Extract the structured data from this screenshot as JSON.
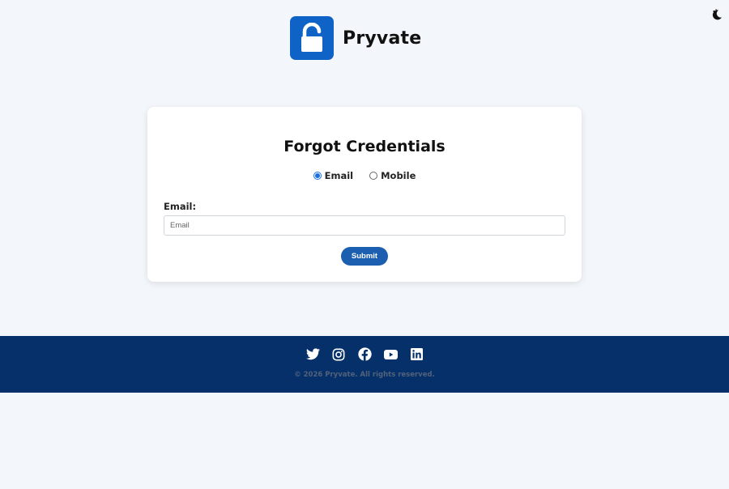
{
  "brand": {
    "name": "Pryvate",
    "accent": "#0f63c7"
  },
  "theme_toggle": {
    "icon": "moon-icon"
  },
  "form": {
    "title": "Forgot Credentials",
    "methods": [
      {
        "label": "Email",
        "checked": true
      },
      {
        "label": "Mobile",
        "checked": false
      }
    ],
    "field_label": "Email:",
    "input": {
      "placeholder": "Email",
      "value": ""
    },
    "submit_label": "Submit",
    "submit_color": "#1c5fb0"
  },
  "footer": {
    "background": "#06306a",
    "social_icons": [
      "twitter-icon",
      "instagram-icon",
      "facebook-icon",
      "youtube-icon",
      "linkedin-icon"
    ],
    "copyright": "© 2026 Pryvate. All rights reserved."
  }
}
